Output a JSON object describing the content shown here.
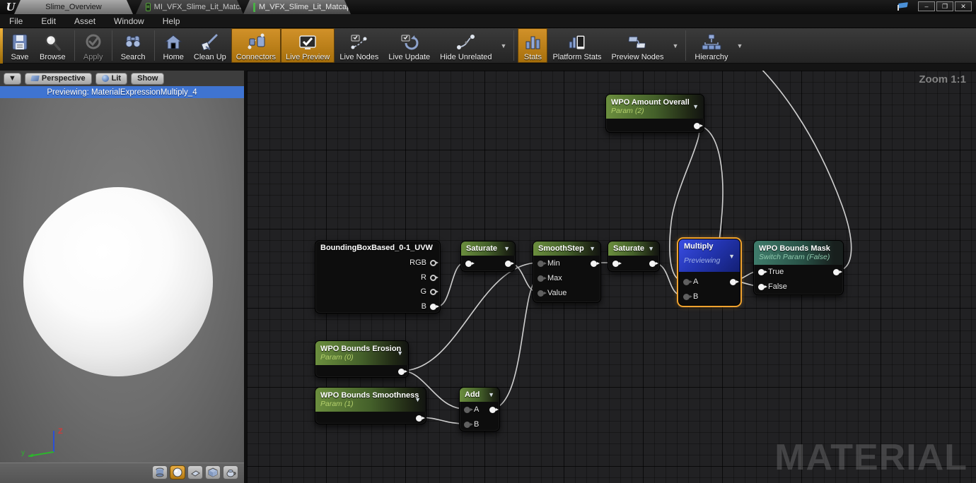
{
  "window": {
    "logo": "U",
    "tabs": [
      {
        "label": "Slime_Overview",
        "active": false
      },
      {
        "label": "MI_VFX_Slime_Lit_Matcap",
        "icon": "material-instance-icon",
        "close": "x",
        "active": false
      },
      {
        "label": "M_VFX_Slime_Lit_Matcap",
        "icon": "material-icon",
        "close": "x",
        "active": true
      }
    ],
    "controls": {
      "minimize": "–",
      "restore": "❐",
      "close": "✕"
    }
  },
  "menu": {
    "items": [
      "File",
      "Edit",
      "Asset",
      "Window",
      "Help"
    ]
  },
  "toolbar": {
    "highlight_color": "#c1821a",
    "items": [
      {
        "label": "Save",
        "icon": "save-icon",
        "state": "normal"
      },
      {
        "label": "Browse",
        "icon": "browse-icon",
        "state": "normal"
      },
      {
        "label": "Apply",
        "icon": "apply-icon",
        "state": "disabled"
      },
      {
        "label": "Search",
        "icon": "search-icon",
        "state": "normal"
      },
      {
        "label": "Home",
        "icon": "home-icon",
        "state": "normal"
      },
      {
        "label": "Clean Up",
        "icon": "clean-up-icon",
        "state": "normal"
      },
      {
        "label": "Connectors",
        "icon": "connectors-icon",
        "state": "active"
      },
      {
        "label": "Live Preview",
        "icon": "live-preview-icon",
        "state": "active"
      },
      {
        "label": "Live Nodes",
        "icon": "live-nodes-icon",
        "state": "normal"
      },
      {
        "label": "Live Update",
        "icon": "live-update-icon",
        "state": "normal"
      },
      {
        "label": "Hide Unrelated",
        "icon": "hide-unrelated-icon",
        "state": "normal",
        "caret": true
      },
      {
        "label": "Stats",
        "icon": "stats-icon",
        "state": "active"
      },
      {
        "label": "Platform Stats",
        "icon": "platform-stats-icon",
        "state": "normal"
      },
      {
        "label": "Preview Nodes",
        "icon": "preview-nodes-icon",
        "state": "normal",
        "caret": true
      },
      {
        "label": "Hierarchy",
        "icon": "hierarchy-icon",
        "state": "normal",
        "caret": true
      }
    ]
  },
  "viewport": {
    "perspective_label": "Perspective",
    "lit_label": "Lit",
    "show_label": "Show",
    "previewing_text": "Previewing: MaterialExpressionMultiply_4",
    "shape_buttons": [
      "cylinder",
      "sphere",
      "plane",
      "cube",
      "teapot"
    ],
    "selected_shape": "sphere",
    "axis": {
      "y_label": "y",
      "z_label": "Z"
    }
  },
  "graph": {
    "zoom_label": "Zoom 1:1",
    "watermark": "MATERIAL",
    "selection_color": "#efa22f",
    "nodes": [
      {
        "title": "WPO Amount Overall",
        "subtitle": "Param (2)",
        "header": "green",
        "outputs": [
          {
            "label": "",
            "state": "white"
          }
        ]
      },
      {
        "title": "BoundingBoxBased_0-1_UVW",
        "header": "slate",
        "outputs": [
          {
            "label": "RGB",
            "state": "hollow"
          },
          {
            "label": "R",
            "state": "hollow"
          },
          {
            "label": "G",
            "state": "hollow"
          },
          {
            "label": "B",
            "state": "white"
          }
        ]
      },
      {
        "title": "Saturate",
        "header": "green",
        "inputs": [
          {
            "label": "",
            "state": "white"
          }
        ],
        "outputs": [
          {
            "label": "",
            "state": "white"
          }
        ]
      },
      {
        "title": "SmoothStep",
        "header": "green",
        "inputs": [
          {
            "label": "Min",
            "state": "grey"
          },
          {
            "label": "Max",
            "state": "grey"
          },
          {
            "label": "Value",
            "state": "grey"
          }
        ],
        "outputs": [
          {
            "label": "",
            "state": "white"
          }
        ]
      },
      {
        "title": "Saturate",
        "header": "green",
        "inputs": [
          {
            "label": "",
            "state": "white"
          }
        ],
        "outputs": [
          {
            "label": "",
            "state": "white"
          }
        ]
      },
      {
        "title": "Multiply",
        "subtitle": "Previewing",
        "header": "blue",
        "selected": true,
        "inputs": [
          {
            "label": "A",
            "state": "grey"
          },
          {
            "label": "B",
            "state": "grey"
          }
        ],
        "outputs": [
          {
            "label": "",
            "state": "white"
          }
        ]
      },
      {
        "title": "WPO Bounds Mask",
        "subtitle": "Switch Param (False)",
        "header": "teal",
        "inputs": [
          {
            "label": "True",
            "state": "white"
          },
          {
            "label": "False",
            "state": "white"
          }
        ],
        "outputs": [
          {
            "label": "",
            "state": "white"
          }
        ]
      },
      {
        "title": "WPO Bounds Erosion",
        "subtitle": "Param (0)",
        "header": "green",
        "outputs": [
          {
            "label": "",
            "state": "white"
          }
        ]
      },
      {
        "title": "WPO Bounds Smoothness",
        "subtitle": "Param (1)",
        "header": "green",
        "outputs": [
          {
            "label": "",
            "state": "white"
          }
        ]
      },
      {
        "title": "Add",
        "header": "green",
        "inputs": [
          {
            "label": "A",
            "state": "grey"
          },
          {
            "label": "B",
            "state": "grey"
          }
        ],
        "outputs": [
          {
            "label": "",
            "state": "white"
          }
        ]
      }
    ],
    "connections": [
      {
        "from": "BoundingBoxBased_0-1_UVW.B",
        "to": "Saturate_1.In"
      },
      {
        "from": "Saturate_1.Out",
        "to": "SmoothStep.Value"
      },
      {
        "from": "WPO Bounds Erosion.Out",
        "to": "SmoothStep.Min"
      },
      {
        "from": "WPO Bounds Erosion.Out",
        "to": "Add.A"
      },
      {
        "from": "WPO Bounds Smoothness.Out",
        "to": "Add.B"
      },
      {
        "from": "Add.Out",
        "to": "SmoothStep.Max"
      },
      {
        "from": "SmoothStep.Out",
        "to": "Saturate_2.In"
      },
      {
        "from": "Saturate_2.Out",
        "to": "Multiply.B"
      },
      {
        "from": "WPO Amount Overall.Out",
        "to": "Multiply.A"
      },
      {
        "from": "Multiply.Out",
        "to": "WPO Bounds Mask.True"
      },
      {
        "from": "Multiply.Out",
        "to": "WPO Bounds Mask.False"
      },
      {
        "from": "WPO Bounds Mask.Out",
        "to": "offscreen-top"
      }
    ]
  }
}
